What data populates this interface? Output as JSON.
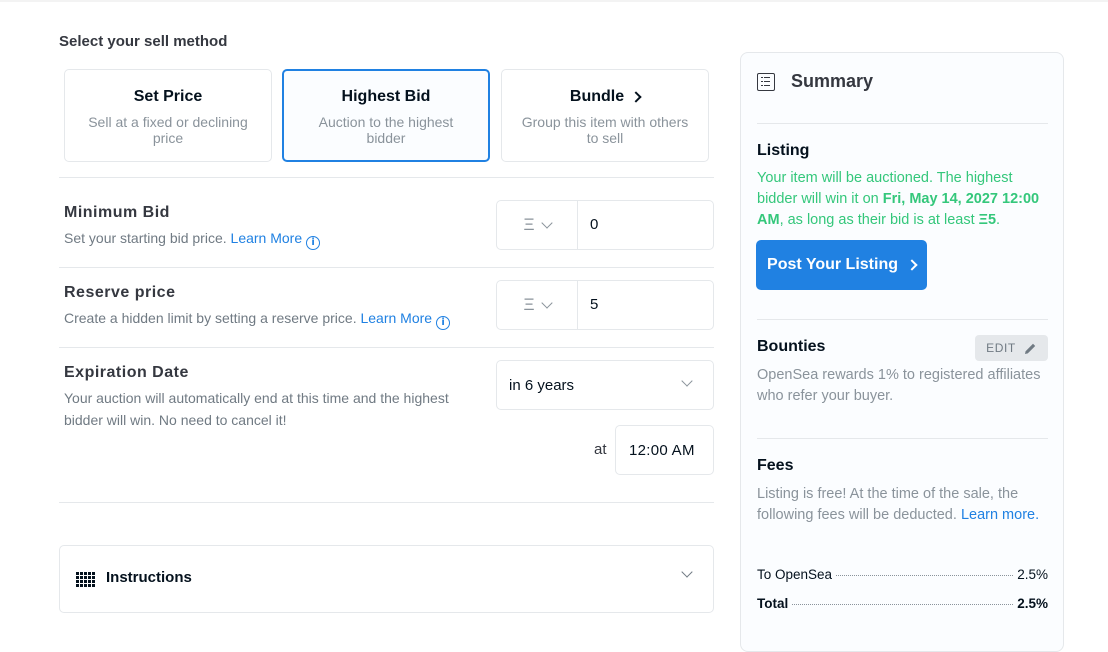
{
  "sell_method": {
    "title": "Select your sell method",
    "options": [
      {
        "label": "Set Price",
        "description": "Sell at a fixed or declining price"
      },
      {
        "label": "Highest Bid",
        "description": "Auction to the highest bidder",
        "selected": true
      },
      {
        "label": "Bundle",
        "description": "Group this item with others to sell"
      }
    ]
  },
  "minimum_bid": {
    "title": "Minimum Bid",
    "description": "Set your starting bid price.",
    "learn_more": "Learn More",
    "currency_icon": "eth-icon",
    "value": "0"
  },
  "reserve_price": {
    "title": "Reserve price",
    "description": "Create a hidden limit by setting a reserve price.",
    "learn_more": "Learn More",
    "currency_icon": "eth-icon",
    "value": "5"
  },
  "expiration": {
    "title": "Expiration Date",
    "description": "Your auction will automatically end at this time and the highest bidder will win. No need to cancel it!",
    "selected": "in 6 years",
    "at_label": "at",
    "time": "12:00 AM"
  },
  "instructions": {
    "label": "Instructions"
  },
  "summary": {
    "title": "Summary",
    "listing": {
      "title": "Listing",
      "text_before": "Your item will be auctioned. The highest bidder will win it on ",
      "date": "Fri, May 14, 2027 12:00 AM",
      "text_middle": ", as long as their bid is at least ",
      "min_amount": "Ξ5",
      "text_end": ".",
      "post_button": "Post Your Listing"
    },
    "bounties": {
      "title": "Bounties",
      "edit_label": "EDIT",
      "text": "OpenSea rewards 1% to registered affiliates who refer your buyer."
    },
    "fees": {
      "title": "Fees",
      "text": "Listing is free! At the time of the sale, the following fees will be deducted.",
      "learn_more": "Learn more.",
      "rows": [
        {
          "label": "To OpenSea",
          "value": "2.5%"
        },
        {
          "label": "Total",
          "value": "2.5%"
        }
      ]
    }
  },
  "colors": {
    "accent": "#2081e2",
    "success": "#34c77b",
    "border": "#e5e8eb"
  }
}
